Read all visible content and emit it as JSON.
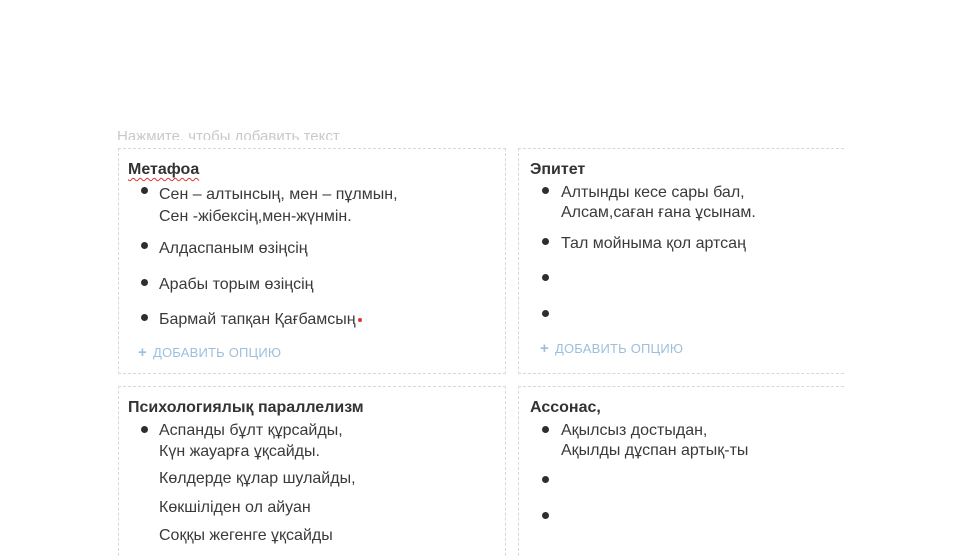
{
  "hint": "Нажмите, чтобы добавить текст",
  "add_option_label": "ДОБАВИТЬ ОПЦИЮ",
  "cards": {
    "metaphor": {
      "title": "Метафоа",
      "items": [
        "Сен – алтынсың, мен – пұлмын,",
        "Сен -жібексің,мен-жүнмін.",
        "Алдаспаным өзіңсің",
        "Арабы торым өзіңсің",
        "Бармай тапқан Қағбамсың"
      ]
    },
    "epithet": {
      "title": "Эпитет",
      "items": [
        "Алтынды кесе сары бал,",
        "Алсам,саған ғана ұсынам.",
        "Тал мойныма қол артсаң",
        "",
        ""
      ]
    },
    "parallelism": {
      "title": "Психологиялық параллелизм",
      "items": [
        "Аспанды бұлт құрсайды,",
        "Күн жауарға ұқсайды.",
        "Көлдерде құлар шулайды,",
        "Көкшіліден ол айуан",
        "Соққы жегенге ұқсайды"
      ]
    },
    "assonance": {
      "title": "Ассонас,",
      "items": [
        "Ақылсыз достыдан,",
        "Ақылды дұспан артық-ты",
        "",
        ""
      ]
    }
  }
}
